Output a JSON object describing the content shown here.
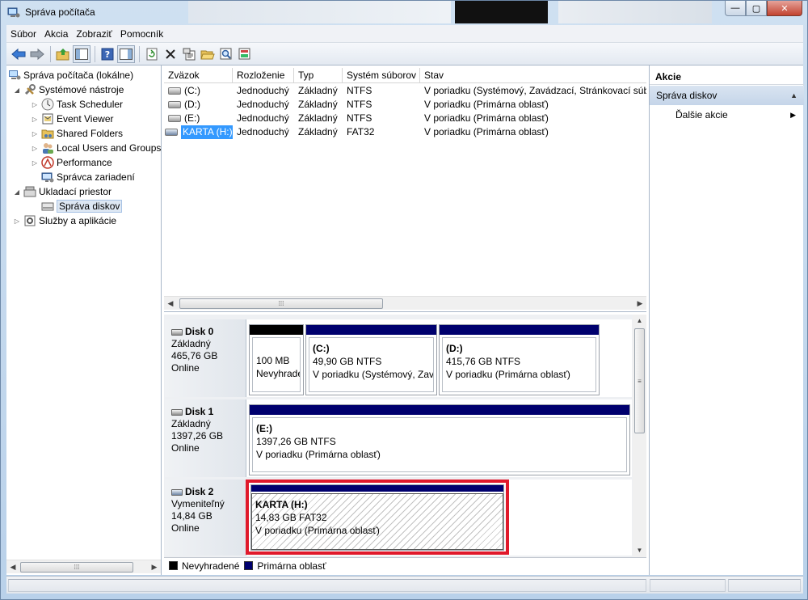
{
  "window": {
    "title": "Správa počítača"
  },
  "menubar": [
    "Súbor",
    "Akcia",
    "Zobraziť",
    "Pomocník"
  ],
  "toolbar": {
    "buttons": [
      "back-arrow-icon",
      "forward-arrow-icon",
      "up-folder-icon",
      "show-hide-tree-icon",
      "help-icon",
      "show-hide-action-pane-icon",
      "refresh-icon",
      "delete-icon",
      "properties-icon",
      "open-folder-icon",
      "search-icon",
      "settings-icon"
    ]
  },
  "tree": {
    "root": "Správa počítača (lokálne)",
    "system_tools": "Systémové nástroje",
    "task_scheduler": "Task Scheduler",
    "event_viewer": "Event Viewer",
    "shared_folders": "Shared Folders",
    "local_users": "Local Users and Groups",
    "performance": "Performance",
    "device_manager": "Správca zariadení",
    "storage": "Ukladací priestor",
    "disk_management": "Správa diskov",
    "services": "Služby a aplikácie"
  },
  "volumes": {
    "headers": [
      "Zväzok",
      "Rozloženie",
      "Typ",
      "Systém súborov",
      "Stav"
    ],
    "rows": [
      {
        "name": "(C:)",
        "layout": "Jednoduchý",
        "type": "Základný",
        "fs": "NTFS",
        "status": "V poriadku (Systémový, Zavádzací, Stránkovací súbo"
      },
      {
        "name": "(D:)",
        "layout": "Jednoduchý",
        "type": "Základný",
        "fs": "NTFS",
        "status": "V poriadku (Primárna oblasť)"
      },
      {
        "name": "(E:)",
        "layout": "Jednoduchý",
        "type": "Základný",
        "fs": "NTFS",
        "status": "V poriadku (Primárna oblasť)"
      },
      {
        "name": "KARTA (H:)",
        "layout": "Jednoduchý",
        "type": "Základný",
        "fs": "FAT32",
        "status": "V poriadku (Primárna oblasť)"
      }
    ]
  },
  "disks": [
    {
      "name": "Disk 0",
      "type": "Základný",
      "size": "465,76 GB",
      "state": "Online",
      "partitions": [
        {
          "name": "",
          "size": "100 MB",
          "status": "Nevyhradené"
        },
        {
          "name": "(C:)",
          "size": "49,90 GB NTFS",
          "status": "V poriadku (Systémový, Zava"
        },
        {
          "name": "(D:)",
          "size": "415,76 GB NTFS",
          "status": "V poriadku (Primárna oblasť)"
        }
      ]
    },
    {
      "name": "Disk 1",
      "type": "Základný",
      "size": "1397,26 GB",
      "state": "Online",
      "partitions": [
        {
          "name": "(E:)",
          "size": "1397,26 GB NTFS",
          "status": "V poriadku (Primárna oblasť)"
        }
      ]
    },
    {
      "name": "Disk 2",
      "type": "Vymeniteľný",
      "size": "14,84 GB",
      "state": "Online",
      "partitions": [
        {
          "name": "KARTA  (H:)",
          "size": "14,83 GB FAT32",
          "status": "V poriadku (Primárna oblasť)"
        }
      ]
    }
  ],
  "legend": {
    "unallocated": "Nevyhradené",
    "primary": "Primárna oblasť"
  },
  "actions": {
    "header": "Akcie",
    "section": "Správa diskov",
    "more": "Ďalšie akcie"
  },
  "colors": {
    "unallocated": "#000000",
    "primary": "#00006e",
    "selection": "#3399ff",
    "highlight": "#e0192b"
  }
}
